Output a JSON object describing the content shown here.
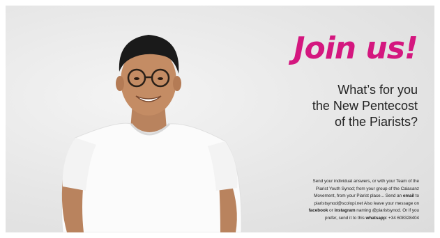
{
  "headline": "Join us!",
  "question_lines": [
    "What’s for you",
    "the New Pentecost",
    "of the Piarists?"
  ],
  "info": {
    "line1": "Send your individual answers, or with your Team of the",
    "line2": "Piarist Youth Synod; from your group of the Calasanz",
    "line3_a": "Movement, from your Piarist place... Send an ",
    "line3_bold": "email",
    "line3_b": " to",
    "line4": "piaristsynod@scolopi.net Also leave your message on",
    "line5_bold1": "facebook",
    "line5_mid": " or ",
    "line5_bold2": "instagram",
    "line5_end": " naming @piaristsynod. Or if you",
    "line6_a": "prefer, send it to this ",
    "line6_bold": "whatsapp",
    "line6_b": ": +34 608328404"
  },
  "colors": {
    "accent": "#d4177f",
    "text": "#222222",
    "background": "#e6e6e6"
  }
}
